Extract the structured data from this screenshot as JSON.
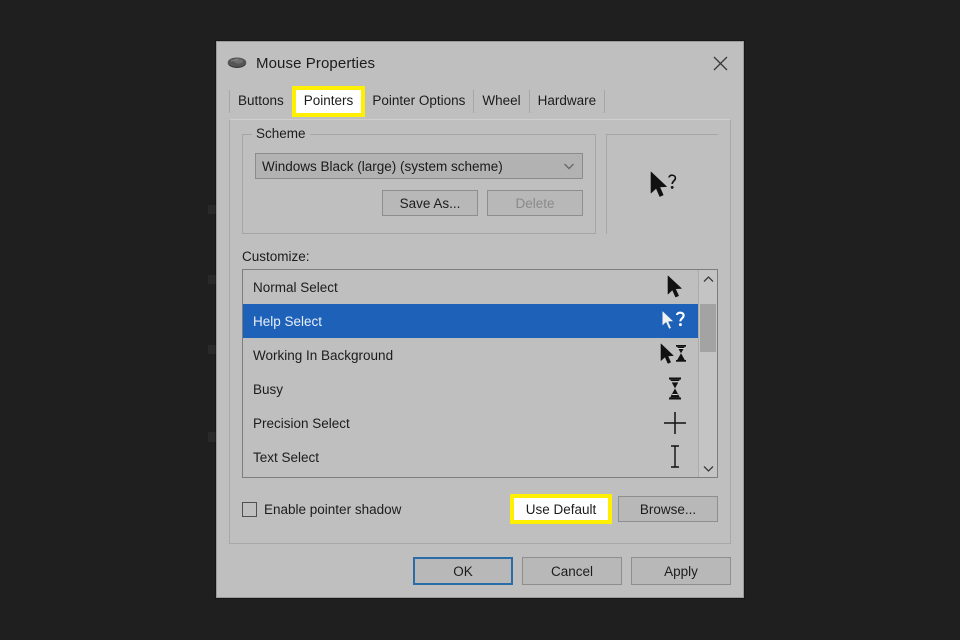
{
  "window": {
    "title": "Mouse Properties",
    "icon": "mouse-icon",
    "close_label": "✕"
  },
  "tabs": [
    {
      "label": "Buttons",
      "selected": false,
      "highlighted": false
    },
    {
      "label": "Pointers",
      "selected": true,
      "highlighted": true
    },
    {
      "label": "Pointer Options",
      "selected": false,
      "highlighted": false
    },
    {
      "label": "Wheel",
      "selected": false,
      "highlighted": false
    },
    {
      "label": "Hardware",
      "selected": false,
      "highlighted": false
    }
  ],
  "scheme": {
    "legend": "Scheme",
    "combo_value": "Windows Black (large) (system scheme)",
    "combo_icon": "chevron-down-icon",
    "save_as_label": "Save As...",
    "delete_label": "Delete",
    "delete_disabled": true,
    "preview_cursor": "help-select-cursor"
  },
  "customize": {
    "label": "Customize:",
    "rows": [
      {
        "label": "Normal Select",
        "icon": "arrow-cursor",
        "selected": false
      },
      {
        "label": "Help Select",
        "icon": "arrow-question-cursor",
        "selected": true
      },
      {
        "label": "Working In Background",
        "icon": "arrow-hourglass-cursor",
        "selected": false
      },
      {
        "label": "Busy",
        "icon": "hourglass-cursor",
        "selected": false
      },
      {
        "label": "Precision Select",
        "icon": "crosshair-cursor",
        "selected": false
      },
      {
        "label": "Text Select",
        "icon": "ibeam-cursor",
        "selected": false
      }
    ],
    "scrollbar": {
      "up_icon": "chevron-up-icon",
      "down_icon": "chevron-down-icon"
    }
  },
  "options": {
    "shadow_checkbox_label": "Enable pointer shadow",
    "shadow_checked": false,
    "use_default_label": "Use Default",
    "browse_label": "Browse..."
  },
  "footer": {
    "ok_label": "OK",
    "cancel_label": "Cancel",
    "apply_label": "Apply"
  },
  "colors": {
    "dialog_bg": "#bfbfbf",
    "selection_blue": "#1d62b8",
    "highlight_yellow": "#ffef00",
    "focus_blue": "#2a6ca8",
    "desktop_bg": "#1e1e1e"
  }
}
